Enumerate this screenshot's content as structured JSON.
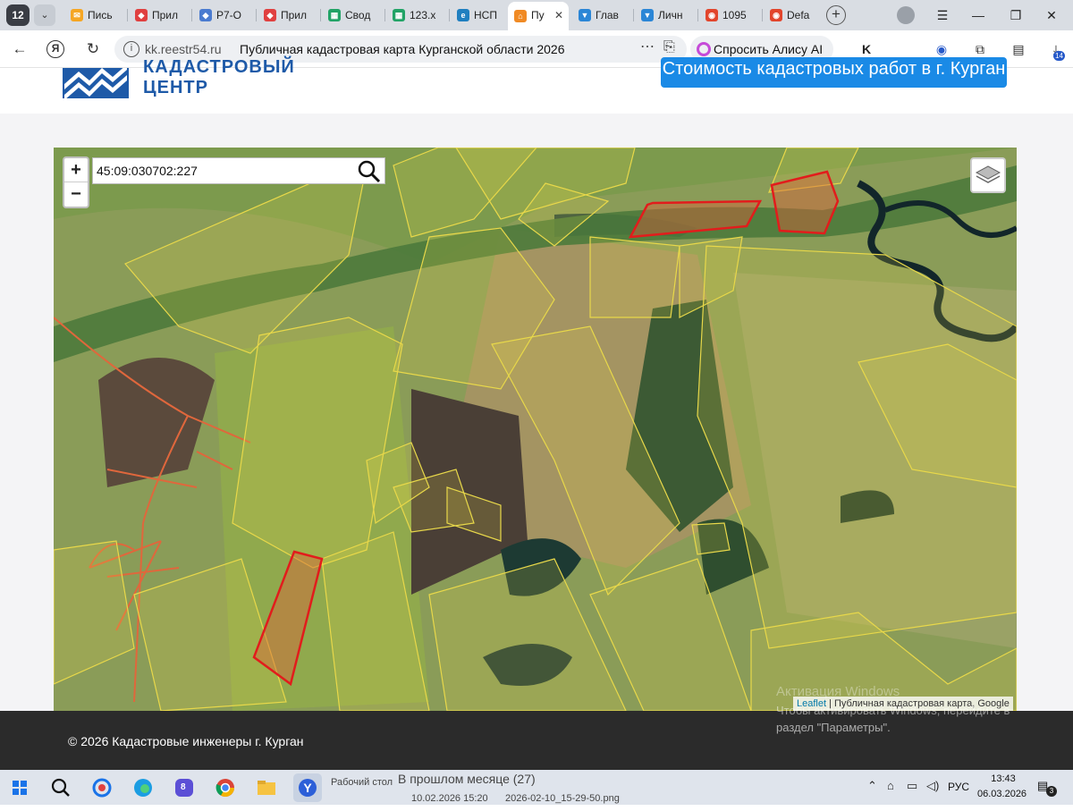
{
  "browser": {
    "tab_count": "12",
    "tabs": [
      {
        "label": "Пись",
        "color": "#f5a623",
        "glyph": "✉"
      },
      {
        "label": "Прил",
        "color": "#e04040",
        "glyph": "◆"
      },
      {
        "label": "Р7-О",
        "color": "#4a7bd0",
        "glyph": "◆"
      },
      {
        "label": "Прил",
        "color": "#e04040",
        "glyph": "◆"
      },
      {
        "label": "Свод",
        "color": "#21a366",
        "glyph": "▦"
      },
      {
        "label": "123.x",
        "color": "#21a366",
        "glyph": "▦"
      },
      {
        "label": "НСП",
        "color": "#1f7fc0",
        "glyph": "e"
      },
      {
        "label": "Пу",
        "color": "#f08a24",
        "glyph": "⌂"
      },
      {
        "label": "Глав",
        "color": "#2b86d6",
        "glyph": "▼"
      },
      {
        "label": "Личн",
        "color": "#2b86d6",
        "glyph": "▼"
      },
      {
        "label": "1095",
        "color": "#e2452c",
        "glyph": "◉"
      },
      {
        "label": "Defa",
        "color": "#e2452c",
        "glyph": "◉"
      }
    ],
    "active_tab_close": "✕",
    "new_tab": "+",
    "window_controls": {
      "menu": "☰",
      "minimize": "—",
      "restore": "❐",
      "close": "✕"
    },
    "nav": {
      "back": "←",
      "ya": "Я",
      "reload": "↻"
    },
    "url_host": "kk.reestr54.ru",
    "url_title": "Публичная кадастровая карта Курганской области 2026",
    "url_more": "⋯",
    "bookmark": "⎘",
    "alice": "Спросить Алису AI",
    "ext_badge": "14"
  },
  "site": {
    "logo_line1": "КАДАСТРОВЫЙ",
    "logo_line2": "ЦЕНТР",
    "cta": "Стоимость кадастровых работ в г. Курган",
    "brand_color": "#1e5aa8",
    "cta_color": "#1a8ae6"
  },
  "map": {
    "zoom_in": "+",
    "zoom_out": "−",
    "search_value": "45:09:030702:227",
    "search_icon": "search-icon",
    "layers_icon": "layers-icon",
    "attribution_link": "Leaflet",
    "attribution_rest": " | Публичная кадастровая карта, Google",
    "parcel_stroke": "#e8d84a",
    "selected_stroke": "#e21c1c"
  },
  "footer": {
    "copyright": "© 2026 Кадастровые инженеры г. Курган",
    "watermark_line1": "Активация Windows",
    "watermark_line2": "Чтобы активировать Windows, перейдите в",
    "watermark_line3": "раздел \"Параметры\"."
  },
  "taskbar": {
    "peek_desktop": "Рабочий стол",
    "peek_group": "В прошлом месяце (27)",
    "peek_file_date": "10.02.2026 15:20",
    "peek_file_name": "2026-02-10_15-29-50.png",
    "badge_count": "8",
    "lang": "РУС",
    "time": "13:43",
    "date": "06.03.2026",
    "notification_count": "3"
  }
}
